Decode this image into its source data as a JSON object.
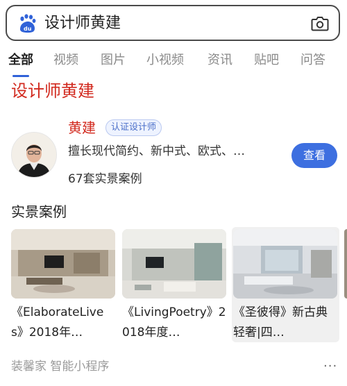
{
  "search": {
    "query": "设计师黄建",
    "logo_icon": "baidu-paw-icon",
    "camera_icon": "camera-icon"
  },
  "tabs": [
    {
      "label": "全部",
      "active": true
    },
    {
      "label": "视频"
    },
    {
      "label": "图片"
    },
    {
      "label": "小视频"
    },
    {
      "label": "资讯"
    },
    {
      "label": "贴吧"
    },
    {
      "label": "问答"
    }
  ],
  "result": {
    "title": "设计师黄建",
    "designer": {
      "name": "黄建",
      "badge": "认证设计师",
      "description": "擅长现代简约、新中式、欧式、…",
      "cases_count": "67套实景案例",
      "view_button": "查看"
    },
    "section_title": "实景案例",
    "cases": [
      {
        "caption": "《ElaborateLives》2018年…"
      },
      {
        "caption": "《LivingPoetry》2018年度…"
      },
      {
        "caption": "《圣彼得》新古典轻奢|四…"
      }
    ],
    "source": "装馨家  智能小程序",
    "more_label": "···"
  },
  "colors": {
    "accent_red": "#d22a1f",
    "accent_blue": "#3d6fe0",
    "tab_inactive": "#8a8a8a"
  }
}
